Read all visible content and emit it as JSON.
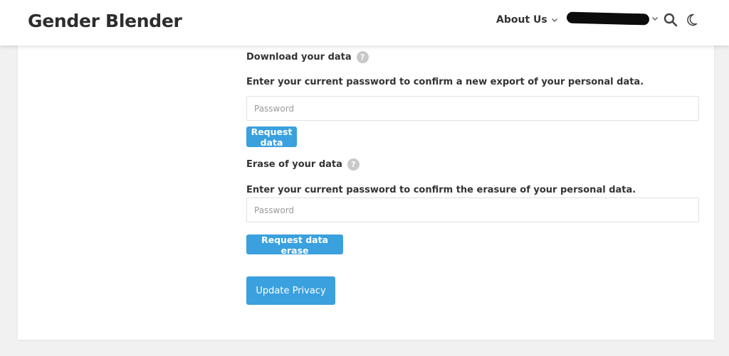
{
  "header": {
    "logo": "Gender Blender",
    "nav_about": "About Us",
    "nav_user": "redacted"
  },
  "download": {
    "title": "Download your data",
    "help": "?",
    "description": "Enter your current password to confirm a new export of your personal data.",
    "password_placeholder": "Password",
    "button": "Request data"
  },
  "erase": {
    "title": "Erase of your data",
    "help": "?",
    "description": "Enter your current password to confirm the erasure of your personal data.",
    "password_placeholder": "Password",
    "button": "Request data erase"
  },
  "update_button": "Update Privacy",
  "colors": {
    "accent": "#3aa0de",
    "background": "#f1f1f1",
    "card": "#ffffff",
    "text": "#2a2a2a"
  }
}
